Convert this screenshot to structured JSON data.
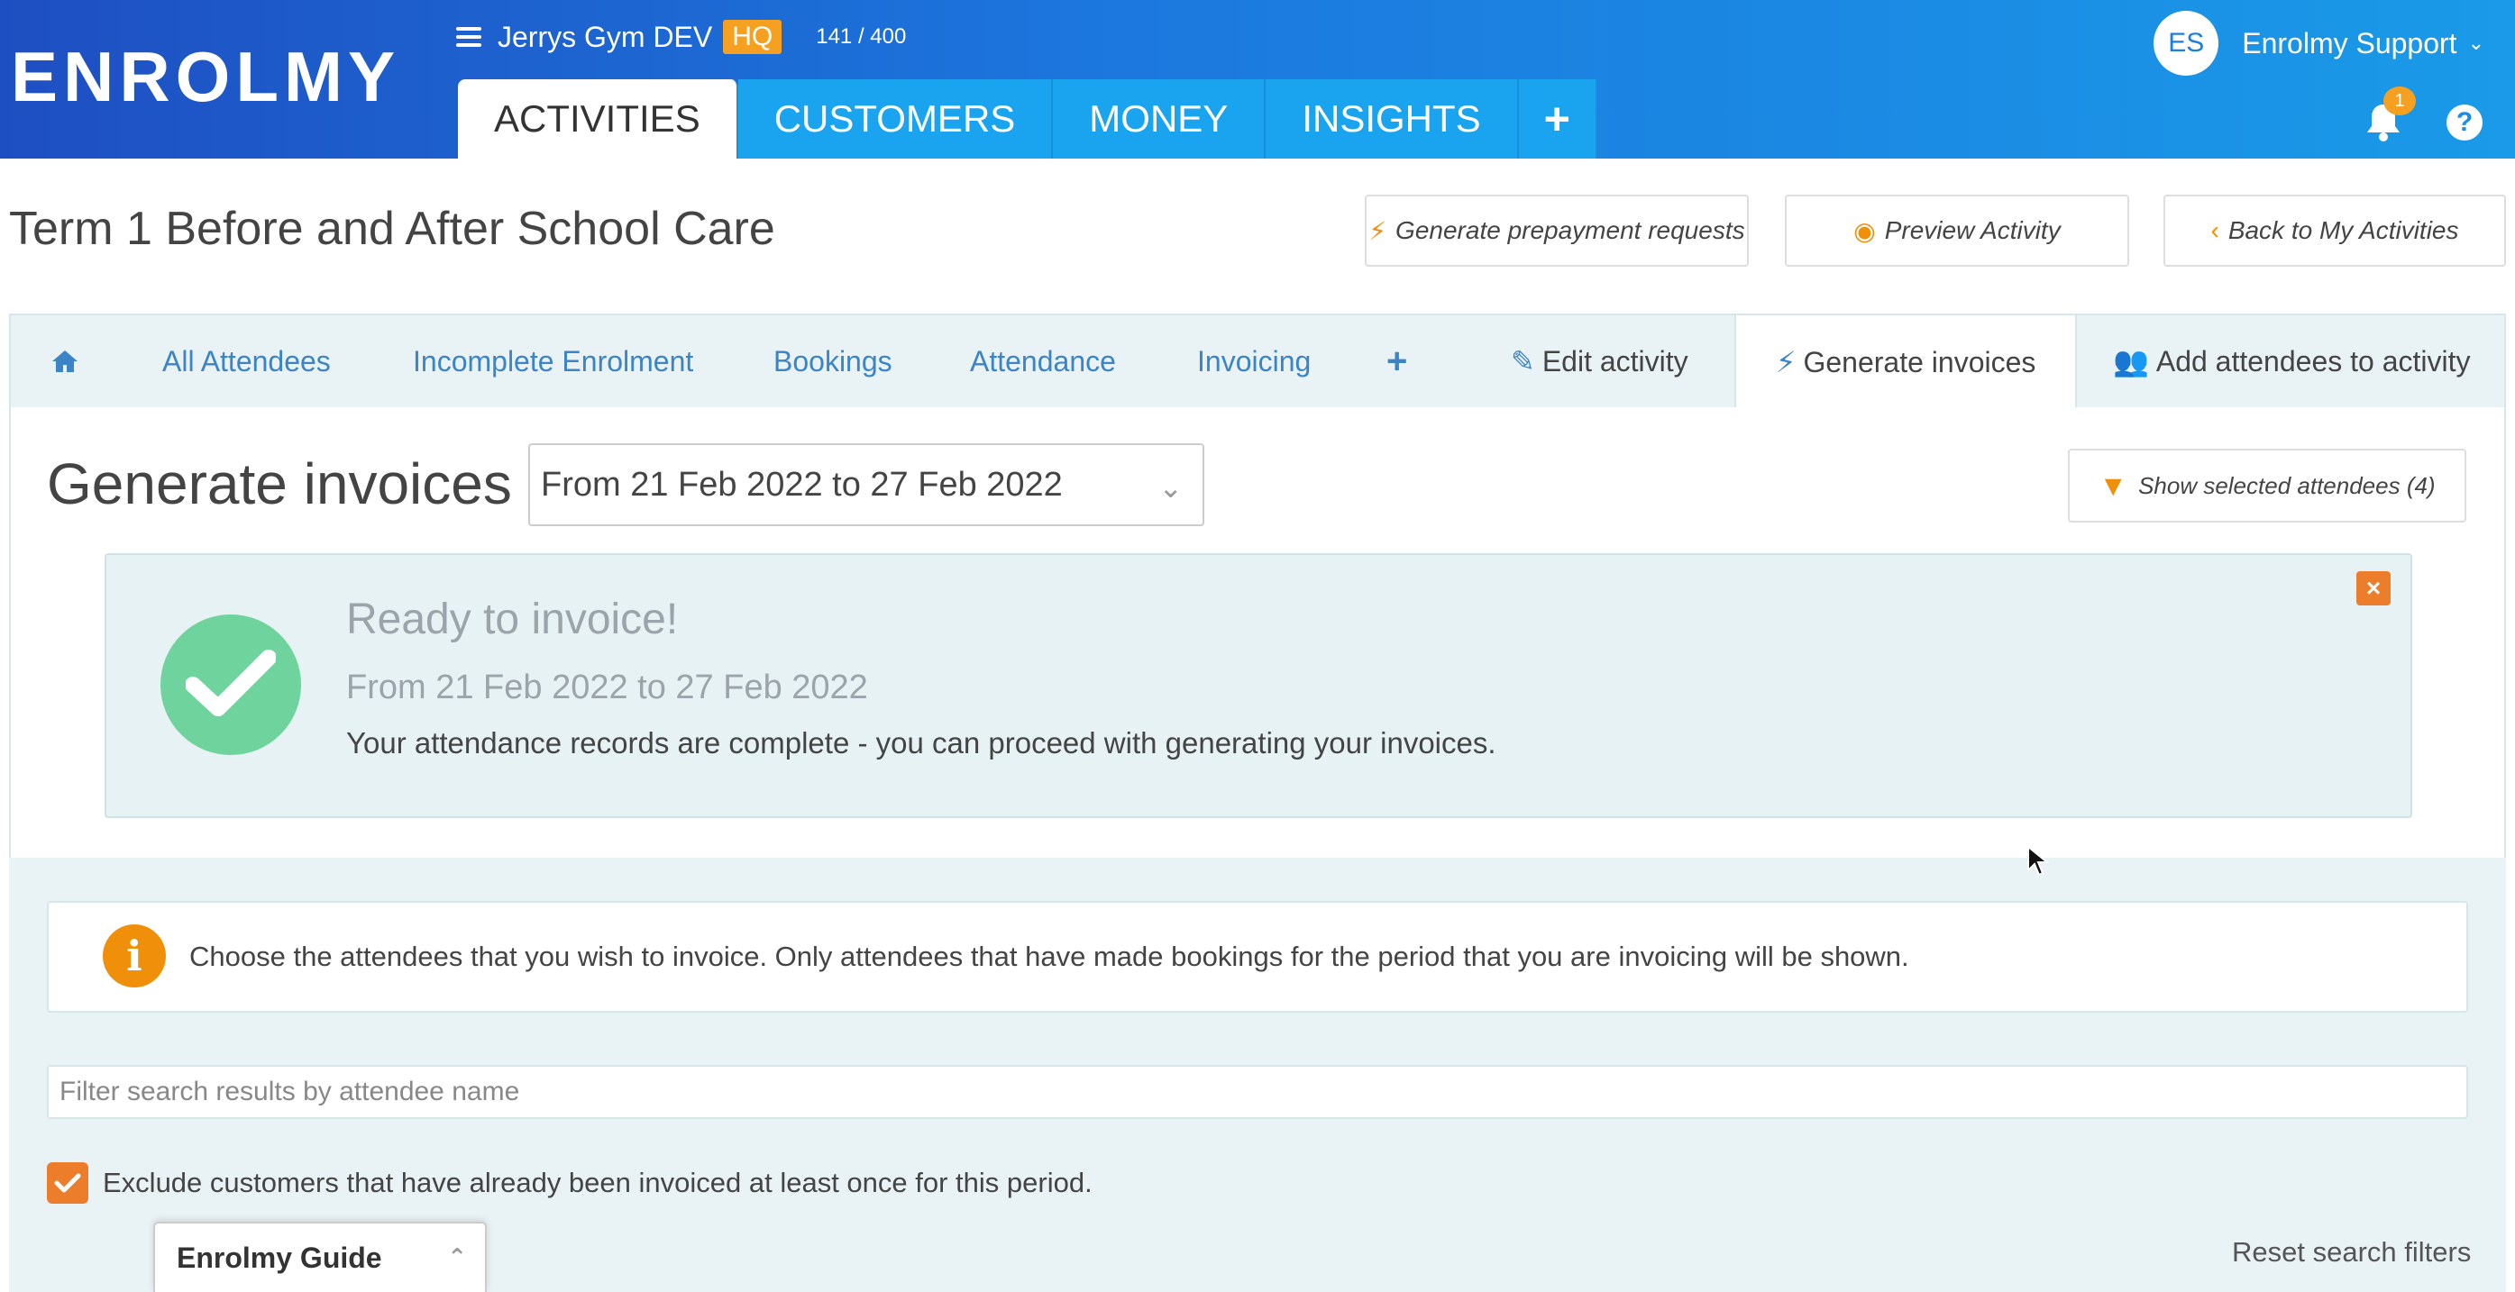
{
  "header": {
    "logo": "ENROLMY",
    "org_name": "Jerrys Gym DEV",
    "org_badge": "HQ",
    "usage": "141 / 400",
    "nav": [
      "ACTIVITIES",
      "CUSTOMERS",
      "MONEY",
      "INSIGHTS"
    ],
    "nav_plus": "+",
    "user": {
      "initials": "ES",
      "name": "Enrolmy Support"
    },
    "notifications": "1",
    "help": "?"
  },
  "page": {
    "title": "Term 1 Before and After School Care",
    "actions": [
      "Generate prepayment requests",
      "Preview Activity",
      "Back to My Activities"
    ]
  },
  "subtabs": {
    "all_attendees": "All Attendees",
    "incomplete": "Incomplete Enrolment",
    "bookings": "Bookings",
    "attendance": "Attendance",
    "invoicing": "Invoicing",
    "plus": "+",
    "edit": "Edit activity",
    "generate": "Generate invoices",
    "add": "Add attendees to activity"
  },
  "generate": {
    "title": "Generate invoices",
    "range": "From 21 Feb 2022 to 27 Feb 2022",
    "show_selected": "Show selected attendees (4)"
  },
  "ready": {
    "title": "Ready to invoice!",
    "range": "From 21 Feb 2022 to 27 Feb 2022",
    "message": "Your attendance records are complete - you can proceed with generating your invoices."
  },
  "info": {
    "text": "Choose the attendees that you wish to invoice. Only attendees that have made bookings for the period that you are invoicing will be shown."
  },
  "filter": {
    "placeholder": "Filter search results by attendee name"
  },
  "exclude": {
    "label": "Exclude customers that have already been invoiced at least once for this period.",
    "checked": true
  },
  "reset": "Reset search filters",
  "guide": "Enrolmy Guide",
  "colors": {
    "accent": "#f0900a",
    "brand": "#1b7fe0",
    "success": "#6fd39d",
    "link": "#3b84c6"
  }
}
